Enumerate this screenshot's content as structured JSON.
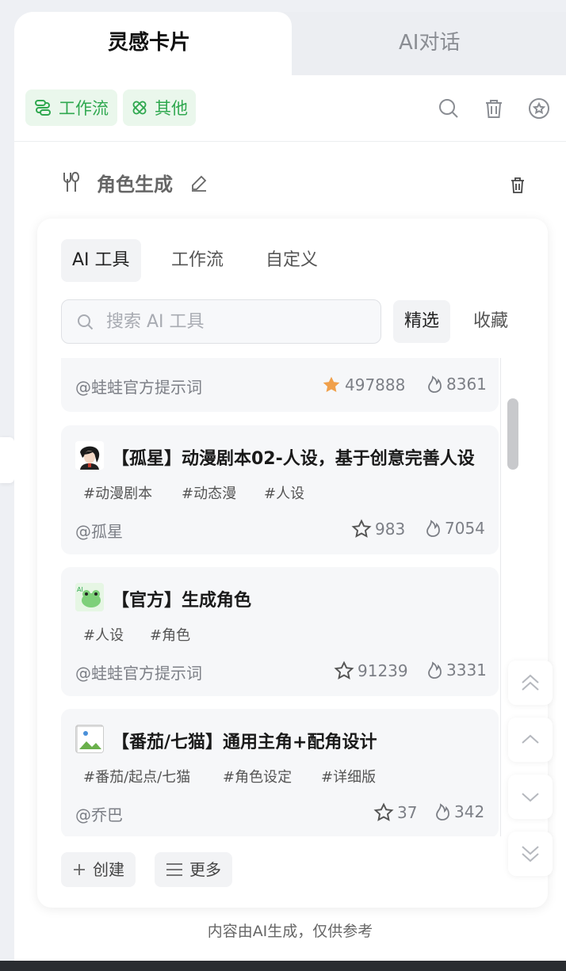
{
  "tabs": {
    "left": "灵感卡片",
    "right": "AI对话"
  },
  "toolbar": {
    "chips": [
      "工作流",
      "其他"
    ],
    "icons": [
      "search-icon",
      "trash-icon",
      "star-circle-icon"
    ]
  },
  "card": {
    "title": "角色生成"
  },
  "subtabs": [
    "AI 工具",
    "工作流",
    "自定义"
  ],
  "search": {
    "placeholder": "搜索 AI 工具"
  },
  "filters": [
    "精选",
    "收藏"
  ],
  "items": [
    {
      "title": "",
      "tags": [],
      "author": "@蛙蛙官方提示词",
      "stars": "497888",
      "hot": "8361",
      "starred": true
    },
    {
      "title": "【孤星】动漫剧本02-人设，基于创意完善人设",
      "tags": [
        "#动漫剧本",
        "#动态漫",
        "#人设"
      ],
      "author": "@孤星",
      "stars": "983",
      "hot": "7054",
      "starred": false
    },
    {
      "title": "【官方】生成角色",
      "tags": [
        "#人设",
        "#角色"
      ],
      "author": "@蛙蛙官方提示词",
      "stars": "91239",
      "hot": "3331",
      "starred": false
    },
    {
      "title": "【番茄/七猫】通用主角+配角设计",
      "tags": [
        "#番茄/起点/七猫",
        "#角色设定",
        "#详细版"
      ],
      "author": "@乔巴",
      "stars": "37",
      "hot": "342",
      "starred": false
    }
  ],
  "bottom": {
    "create": "创建",
    "more": "更多"
  },
  "footer": "内容由AI生成，仅供参考",
  "colors": {
    "accent": "#2fa84f",
    "star": "#f0a04b"
  }
}
